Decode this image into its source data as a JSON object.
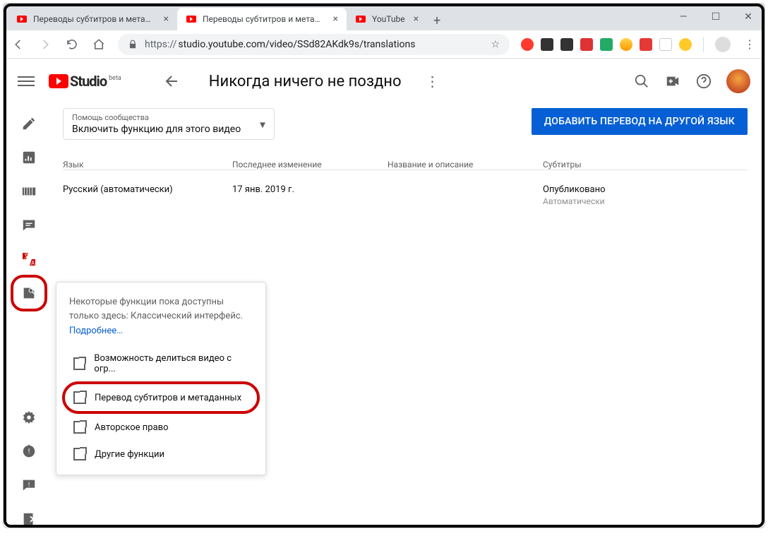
{
  "browser": {
    "tabs": [
      {
        "title": "Переводы субтитров и метадан"
      },
      {
        "title": "Переводы субтитров и метадан"
      },
      {
        "title": "YouTube"
      }
    ],
    "url_prefix": "https://",
    "url": "studio.youtube.com/video/SSd82AKdk9s/translations"
  },
  "header": {
    "logo_text": "Studio",
    "logo_beta": "beta",
    "page_title": "Никогда ничего не поздно"
  },
  "community": {
    "label": "Помощь сообщества",
    "value": "Включить функцию для этого видео"
  },
  "primary_button": "ДОБАВИТЬ ПЕРЕВОД НА ДРУГОЙ ЯЗЫК",
  "table": {
    "headers": {
      "lang": "Язык",
      "modified": "Последнее изменение",
      "name": "Название и описание",
      "subtitles": "Субтитры"
    },
    "rows": [
      {
        "lang": "Русский (автоматически)",
        "modified": "17 янв. 2019 г.",
        "name": "",
        "sub_status": "Опубликовано",
        "sub_secondary": "Автоматически"
      }
    ]
  },
  "classic_menu": {
    "desc": "Некоторые функции пока доступны только здесь: Классический интерфейс.",
    "more": "Подробнее…",
    "items": [
      "Возможность делиться видео с огр...",
      "Перевод субтитров и метаданных",
      "Авторское право",
      "Другие функции"
    ]
  }
}
